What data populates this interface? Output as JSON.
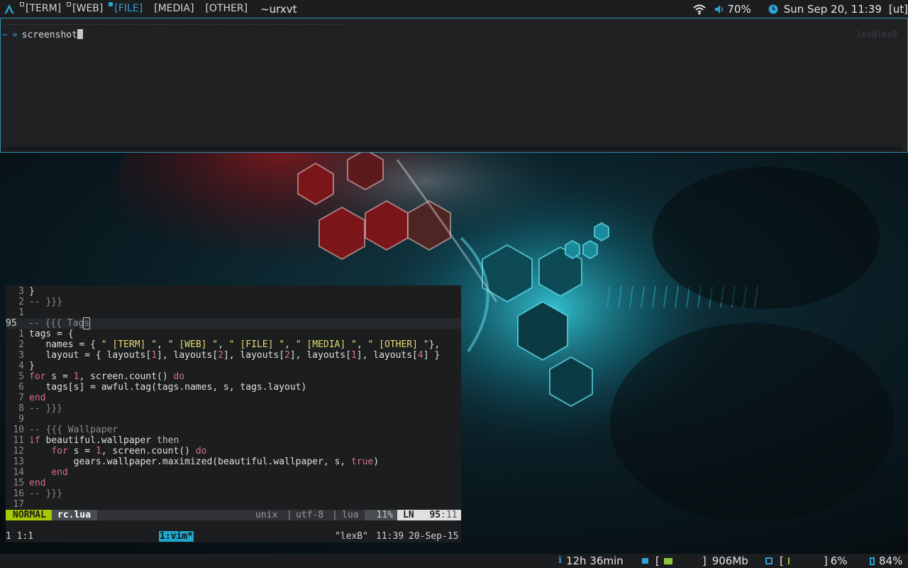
{
  "topbar": {
    "tags": [
      {
        "label": "[TERM]",
        "active": false
      },
      {
        "label": "[WEB]",
        "active": false
      },
      {
        "label": "[FILE]",
        "active": true
      },
      {
        "label": "[MEDIA]",
        "active": false
      },
      {
        "label": "[OTHER]",
        "active": false
      }
    ],
    "window_title": "~urxvt",
    "volume": "70%",
    "clock": "Sun Sep 20, 11:39",
    "layout_indicator": "[ut]"
  },
  "terminal": {
    "prompt_dir": "~",
    "prompt_arrow": "»",
    "command": "screenshot",
    "right_prompt": "lex@lexB"
  },
  "vim": {
    "lines": [
      {
        "num": "3",
        "cur": false,
        "code": "}"
      },
      {
        "num": "2",
        "cur": false,
        "code": "-- }}}"
      },
      {
        "num": "1",
        "cur": false,
        "code": ""
      },
      {
        "num": "95",
        "cur": true,
        "code": "-- {{{ Tags"
      },
      {
        "num": "1",
        "cur": false,
        "code": "tags = {"
      },
      {
        "num": "2",
        "cur": false,
        "code": "   names = { \" [TERM] \", \" [WEB] \", \" [FILE] \", \" [MEDIA] \", \" [OTHER] \"},"
      },
      {
        "num": "3",
        "cur": false,
        "code": "   layout = { layouts[1], layouts[2], layouts[2], layouts[1], layouts[4] }"
      },
      {
        "num": "4",
        "cur": false,
        "code": "}"
      },
      {
        "num": "5",
        "cur": false,
        "code": "for s = 1, screen.count() do"
      },
      {
        "num": "6",
        "cur": false,
        "code": "   tags[s] = awful.tag(tags.names, s, tags.layout)"
      },
      {
        "num": "7",
        "cur": false,
        "code": "end"
      },
      {
        "num": "8",
        "cur": false,
        "code": "-- }}}"
      },
      {
        "num": "9",
        "cur": false,
        "code": ""
      },
      {
        "num": "10",
        "cur": false,
        "code": "-- {{{ Wallpaper"
      },
      {
        "num": "11",
        "cur": false,
        "code": "if beautiful.wallpaper then"
      },
      {
        "num": "12",
        "cur": false,
        "code": "    for s = 1, screen.count() do"
      },
      {
        "num": "13",
        "cur": false,
        "code": "        gears.wallpaper.maximized(beautiful.wallpaper, s, true)"
      },
      {
        "num": "14",
        "cur": false,
        "code": "    end"
      },
      {
        "num": "15",
        "cur": false,
        "code": "end"
      },
      {
        "num": "16",
        "cur": false,
        "code": "-- }}}"
      },
      {
        "num": "17",
        "cur": false,
        "code": ""
      }
    ],
    "status": {
      "mode": "NORMAL",
      "filename": "rc.lua",
      "fileformat": "unix",
      "encoding": "utf-8",
      "filetype": "lua",
      "percent": "11%",
      "ln_label": "LN",
      "position": "95",
      "column": ":11"
    }
  },
  "tmux": {
    "session": "1 1:1",
    "window": "1:vim*",
    "host": "\"lexB\"",
    "time": "11:39",
    "date": "20-Sep-15"
  },
  "bottombar": {
    "uptime": "12h 36min",
    "memory": "906Mb",
    "cpu": "6%",
    "battery": "84%"
  },
  "colors": {
    "accent": "#2fa0d8",
    "vim_mode_bg": "#a6c800",
    "tmux_window_bg": "#1fa6c9"
  }
}
